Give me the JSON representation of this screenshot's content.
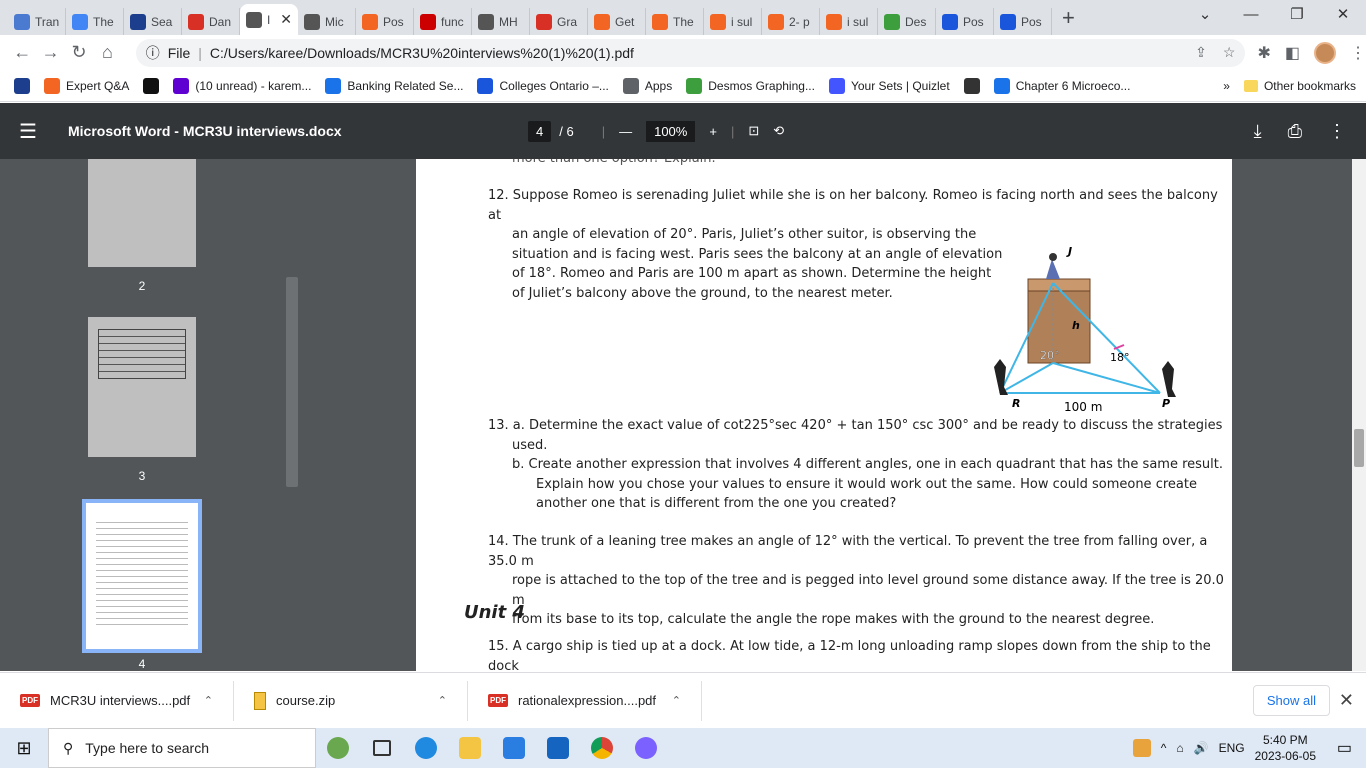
{
  "tabs": [
    {
      "label": "Tran",
      "color": "#4a7bd0",
      "icon": "doc-icon"
    },
    {
      "label": "The",
      "color": "#4285f4",
      "icon": "google-icon"
    },
    {
      "label": "Sea",
      "color": "#1d3e8c",
      "icon": "star-icon"
    },
    {
      "label": "Dan",
      "color": "#d93025",
      "icon": "gmail-icon"
    },
    {
      "label": "I",
      "color": "#555",
      "icon": "globe-icon",
      "active": true
    },
    {
      "label": "Mic",
      "color": "#555",
      "icon": "globe-icon"
    },
    {
      "label": "Pos",
      "color": "#f26522",
      "icon": "chegg-icon"
    },
    {
      "label": "func",
      "color": "#c00",
      "icon": "flower-icon"
    },
    {
      "label": "MH",
      "color": "#555",
      "icon": "globe-icon"
    },
    {
      "label": "Gra",
      "color": "#d93025",
      "icon": "gmail-icon"
    },
    {
      "label": "Get",
      "color": "#f26522",
      "icon": "chegg-icon"
    },
    {
      "label": "The",
      "color": "#f26522",
      "icon": "chegg-icon"
    },
    {
      "label": "i sul",
      "color": "#f26522",
      "icon": "chegg-icon"
    },
    {
      "label": "2- p",
      "color": "#f26522",
      "icon": "chegg-icon"
    },
    {
      "label": "i sul",
      "color": "#f26522",
      "icon": "chegg-icon"
    },
    {
      "label": "Des",
      "color": "#3c9e3c",
      "icon": "desmos-icon"
    },
    {
      "label": "Pos",
      "color": "#1a56db",
      "icon": "z-icon"
    },
    {
      "label": "Pos",
      "color": "#1a56db",
      "icon": "z-icon"
    }
  ],
  "url": {
    "prefix": "File",
    "path": "C:/Users/karee/Downloads/MCR3U%20interviews%20(1)%20(1).pdf"
  },
  "bookmarks": [
    {
      "label": "",
      "color": "#1d3e8c"
    },
    {
      "label": "Expert Q&A",
      "color": "#f26522"
    },
    {
      "label": "",
      "color": "#111"
    },
    {
      "label": "(10 unread) - karem...",
      "color": "#5f01d1"
    },
    {
      "label": "Banking Related Se...",
      "color": "#1a73e8"
    },
    {
      "label": "Colleges Ontario –...",
      "color": "#1a56db"
    },
    {
      "label": "Apps",
      "color": "#5f6368"
    },
    {
      "label": "Desmos Graphing...",
      "color": "#3c9e3c"
    },
    {
      "label": "Your Sets | Quizlet",
      "color": "#4255ff"
    },
    {
      "label": "",
      "color": "#333"
    },
    {
      "label": "Chapter 6 Microeco...",
      "color": "#1a73e8"
    }
  ],
  "bookmarks_more": "»",
  "other_bookmarks": "Other bookmarks",
  "pdf": {
    "title": "Microsoft Word - MCR3U interviews.docx",
    "current_page": "4",
    "total_pages": "/ 6",
    "zoom": "100%"
  },
  "thumbs": [
    "2",
    "3",
    "4"
  ],
  "content": {
    "cut_top": "more than one option? Explain.",
    "q12": "12. Suppose Romeo is serenading Juliet while she is on her balcony. Romeo is facing north and sees the balcony at",
    "q12b": "an angle of elevation of 20°. Paris, Juliet’s other suitor, is observing the",
    "q12c": "situation and is facing west. Paris sees the balcony at an angle of elevation",
    "q12d": "of 18°. Romeo and Paris are 100 m apart as shown. Determine the height",
    "q12e": "of Juliet’s balcony above the ground, to the nearest meter.",
    "fig_j": "J",
    "fig_h": "h",
    "fig_a1": "20°",
    "fig_a2": "18°",
    "fig_r": "R",
    "fig_p": "P",
    "fig_d": "100 m",
    "q13a": "13.  a. Determine the exact value of cot225°sec 420° + tan 150° csc 300° and be ready to discuss the strategies",
    "q13a2": "used.",
    "q13b": "b.   Create another expression that involves 4 different angles, one in each quadrant that has the same result.",
    "q13b2": "Explain how you chose your values to ensure it would work out the same.  How could someone create",
    "q13b3": "another one that is different from the one you created?",
    "q14": "14. The trunk of a leaning tree makes an angle of 12° with the vertical. To prevent the tree from falling over, a 35.0 m",
    "q14b": "rope is attached to the top of the tree and is pegged into level ground some distance away. If the tree is 20.0 m",
    "q14c": "from its base to its top, calculate the angle the rope makes with the ground to the nearest degree.",
    "unit": "Unit 4",
    "q15": "15. A cargo ship is tied up at a dock. At low tide, a 12-m long unloading ramp slopes down from the ship to the dock"
  },
  "downloads": [
    {
      "name": "MCR3U interviews....pdf",
      "type": "pdf"
    },
    {
      "name": "course.zip",
      "type": "zip"
    },
    {
      "name": "rationalexpression....pdf",
      "type": "pdf"
    }
  ],
  "show_all": "Show all",
  "taskbar": {
    "search_placeholder": "Type here to search",
    "lang": "ENG",
    "time": "5:40 PM",
    "date": "2023-06-05"
  }
}
